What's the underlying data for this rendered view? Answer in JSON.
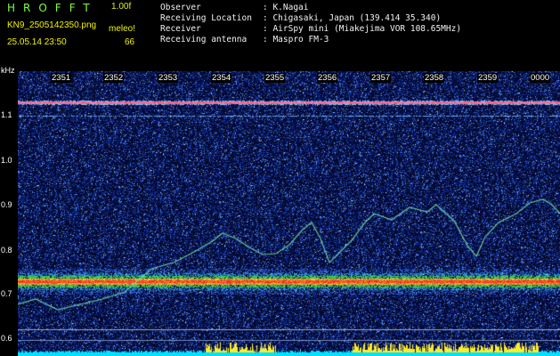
{
  "header": {
    "app_name": "HROFFT",
    "version": "1.00f",
    "filename": "KN9_2505142350.png",
    "timestamp": "25.05.14 23:50",
    "meleor_label": "meleo!",
    "meleor_count": "66"
  },
  "info": {
    "observer_label": "Observer",
    "observer_value": ": K.Nagai",
    "location_label": "Receiving Location",
    "location_value": ": Chigasaki, Japan (139.414 35.340)",
    "receiver_label": "Receiver",
    "receiver_value": ": AirSpy mini (Miakejima VOR 108.65MHz)",
    "antenna_label": "Receiving antenna",
    "antenna_value": ": Maspro FM-3"
  },
  "axis": {
    "unit": "kHz",
    "y_labels": [
      "1.1",
      "1.0",
      "0.9",
      "0.8",
      "0.7",
      "0.6"
    ],
    "time_labels": [
      "2351",
      "2352",
      "2353",
      "2354",
      "2355",
      "2356",
      "2357",
      "2358",
      "2359",
      "0000"
    ]
  },
  "colors": {
    "background": "#000000",
    "noise_low": "#0a1a6a",
    "noise_mid": "#2a5acc",
    "carrier_red": "#ff2a2a",
    "carrier_green": "#40d060",
    "trace": "#6fe0b0",
    "header_yellow": "#f2f200",
    "header_green": "#7fff3f",
    "bottom_bar": "#00e5ff"
  }
}
